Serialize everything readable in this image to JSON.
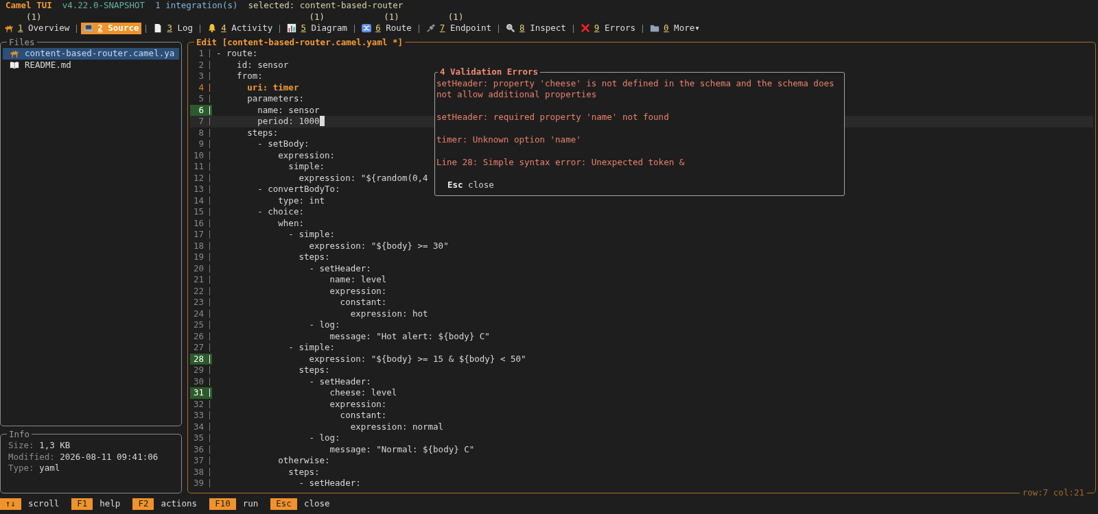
{
  "app": {
    "title": "Camel TUI",
    "version": "v4.22.0-SNAPSHOT",
    "integrations": "1 integration(s)",
    "selected": "selected: content-based-router"
  },
  "tabs": [
    {
      "key": "1",
      "label": "Overview",
      "count": "(1)",
      "selected": false
    },
    {
      "key": "2",
      "label": "Source",
      "selected": true
    },
    {
      "key": "3",
      "label": "Log",
      "selected": false
    },
    {
      "key": "4",
      "label": "Activity",
      "selected": false
    },
    {
      "key": "5",
      "label": "Diagram",
      "count": "(1)",
      "selected": false
    },
    {
      "key": "6",
      "label": "Route",
      "count": "(1)",
      "selected": false
    },
    {
      "key": "7",
      "label": "Endpoint",
      "count": "(1)",
      "selected": false
    },
    {
      "key": "8",
      "label": "Inspect",
      "selected": false
    },
    {
      "key": "9",
      "label": "Errors",
      "selected": false
    },
    {
      "key": "0",
      "label": "More▾",
      "selected": false
    }
  ],
  "files": {
    "title": "Files",
    "items": [
      {
        "name": "content-based-router.camel.ya",
        "selected": true
      },
      {
        "name": "README.md",
        "selected": false
      }
    ]
  },
  "info": {
    "title": "Info",
    "rows": [
      {
        "label": "Size:",
        "value": "1,3 KB"
      },
      {
        "label": "Modified:",
        "value": "2026-08-11 09:41:06"
      },
      {
        "label": "Type:",
        "value": "yaml"
      }
    ]
  },
  "editor": {
    "title": "Edit [content-based-router.camel.yaml *]",
    "position": "row:7 col:21",
    "lines": [
      {
        "number": "1",
        "text": "- route:",
        "kind": "normal"
      },
      {
        "number": "2",
        "text": "    id: sensor",
        "kind": "normal"
      },
      {
        "number": "3",
        "text": "    from:",
        "kind": "normal"
      },
      {
        "number": "4",
        "text": "      uri: timer",
        "kind": "highlighted"
      },
      {
        "number": "5",
        "text": "      parameters:",
        "kind": "normal"
      },
      {
        "number": "6",
        "text": "        name: sensor",
        "kind": "marked"
      },
      {
        "number": "7",
        "text": "        period: 1000",
        "kind": "current"
      },
      {
        "number": "8",
        "text": "      steps:",
        "kind": "normal"
      },
      {
        "number": "9",
        "text": "        - setBody:",
        "kind": "normal"
      },
      {
        "number": "10",
        "text": "            expression:",
        "kind": "normal"
      },
      {
        "number": "11",
        "text": "              simple:",
        "kind": "normal"
      },
      {
        "number": "12",
        "text": "                expression: \"${random(0,4",
        "kind": "normal"
      },
      {
        "number": "13",
        "text": "        - convertBodyTo:",
        "kind": "normal"
      },
      {
        "number": "14",
        "text": "            type: int",
        "kind": "normal"
      },
      {
        "number": "15",
        "text": "        - choice:",
        "kind": "normal"
      },
      {
        "number": "16",
        "text": "            when:",
        "kind": "normal"
      },
      {
        "number": "17",
        "text": "              - simple:",
        "kind": "normal"
      },
      {
        "number": "18",
        "text": "                  expression: \"${body} >= 30\"",
        "kind": "normal"
      },
      {
        "number": "19",
        "text": "                steps:",
        "kind": "normal"
      },
      {
        "number": "20",
        "text": "                  - setHeader:",
        "kind": "normal"
      },
      {
        "number": "21",
        "text": "                      name: level",
        "kind": "normal"
      },
      {
        "number": "22",
        "text": "                      expression:",
        "kind": "normal"
      },
      {
        "number": "23",
        "text": "                        constant:",
        "kind": "normal"
      },
      {
        "number": "24",
        "text": "                          expression: hot",
        "kind": "normal"
      },
      {
        "number": "25",
        "text": "                  - log:",
        "kind": "normal"
      },
      {
        "number": "26",
        "text": "                      message: \"Hot alert: ${body} C\"",
        "kind": "normal"
      },
      {
        "number": "27",
        "text": "              - simple:",
        "kind": "normal"
      },
      {
        "number": "28",
        "text": "                  expression: \"${body} >= 15 & ${body} < 50\"",
        "kind": "marked"
      },
      {
        "number": "29",
        "text": "                steps:",
        "kind": "normal"
      },
      {
        "number": "30",
        "text": "                  - setHeader:",
        "kind": "normal"
      },
      {
        "number": "31",
        "text": "                      cheese: level",
        "kind": "marked"
      },
      {
        "number": "32",
        "text": "                      expression:",
        "kind": "normal"
      },
      {
        "number": "33",
        "text": "                        constant:",
        "kind": "normal"
      },
      {
        "number": "34",
        "text": "                          expression: normal",
        "kind": "normal"
      },
      {
        "number": "35",
        "text": "                  - log:",
        "kind": "normal"
      },
      {
        "number": "36",
        "text": "                      message: \"Normal: ${body} C\"",
        "kind": "normal"
      },
      {
        "number": "37",
        "text": "            otherwise:",
        "kind": "normal"
      },
      {
        "number": "38",
        "text": "              steps:",
        "kind": "normal"
      },
      {
        "number": "39",
        "text": "                - setHeader:",
        "kind": "normal"
      }
    ]
  },
  "errors_popup": {
    "title": "4 Validation Errors",
    "errors": [
      "setHeader: property 'cheese' is not defined in the schema and the schema does not allow additional properties",
      "setHeader: required property 'name' not found",
      "timer: Unknown option 'name'",
      "Line 28: Simple syntax error: Unexpected token &"
    ],
    "hint_key": "Esc",
    "hint_label": "close"
  },
  "status_bar": [
    {
      "key": "↑↓",
      "label": "scroll"
    },
    {
      "key": "F1",
      "label": "help"
    },
    {
      "key": "F2",
      "label": "actions"
    },
    {
      "key": "F10",
      "label": "run"
    },
    {
      "key": "Esc",
      "label": "close"
    }
  ]
}
